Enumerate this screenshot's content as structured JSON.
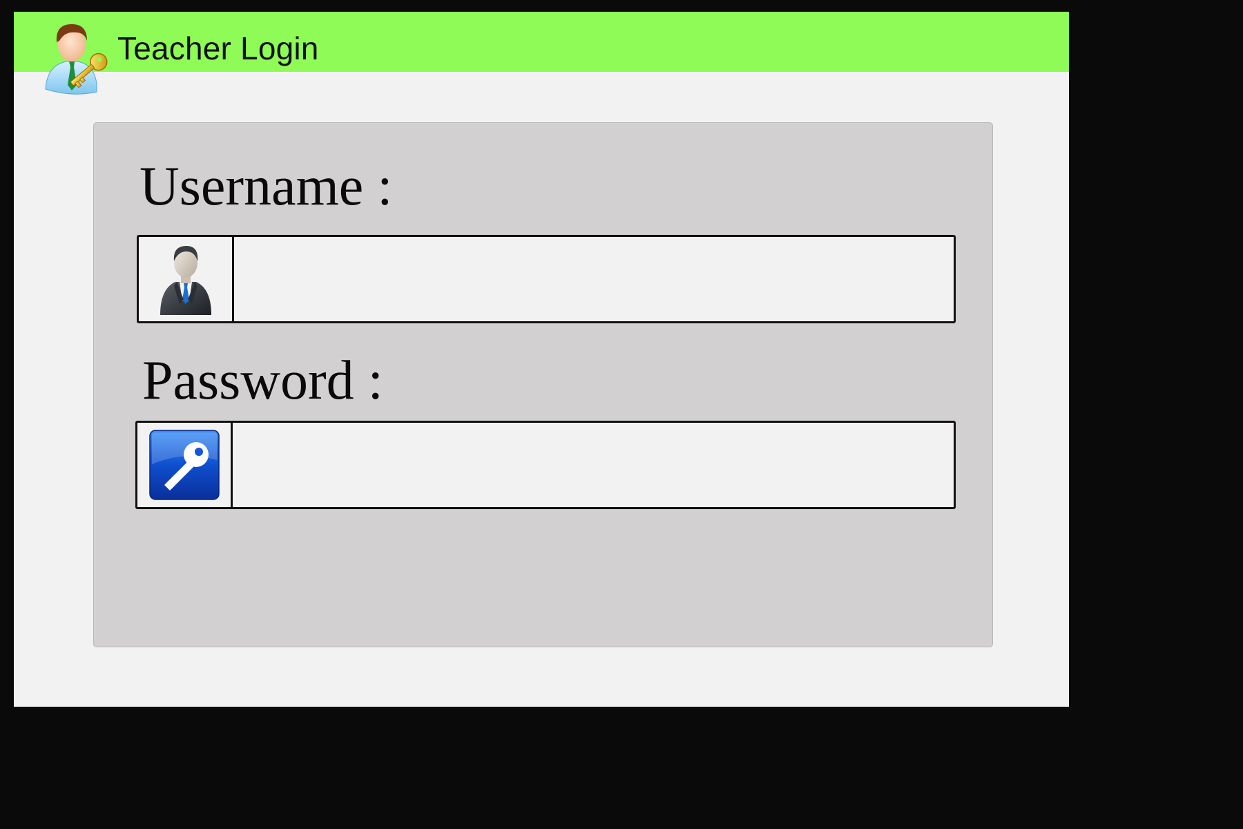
{
  "window": {
    "title": "Teacher Login",
    "app_icon": "teacher-key-icon"
  },
  "form": {
    "username": {
      "label": "Username :",
      "icon": "businessman-icon",
      "value": "",
      "placeholder": ""
    },
    "password": {
      "label": "Password :",
      "icon": "key-icon",
      "value": "",
      "placeholder": ""
    }
  },
  "colors": {
    "titlebar": "#8efb56",
    "background": "#f2f2f2",
    "panel": "#d2d0d1",
    "frame": "#0a0a0a",
    "key_icon_blue": "#1650c8"
  }
}
